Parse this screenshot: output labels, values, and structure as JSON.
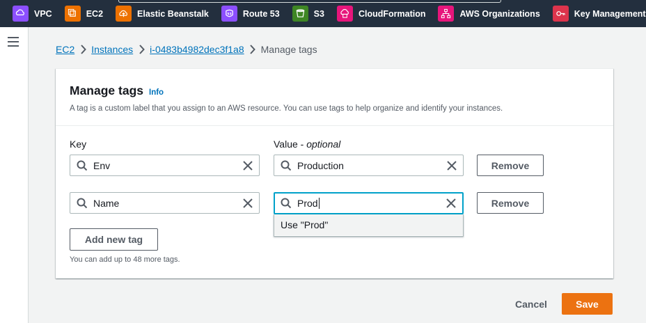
{
  "services": [
    {
      "label": "VPC",
      "icon": "vpc-icon",
      "color": "#8c4fff"
    },
    {
      "label": "EC2",
      "icon": "ec2-icon",
      "color": "#ed7100"
    },
    {
      "label": "Elastic Beanstalk",
      "icon": "elastic-beanstalk-icon",
      "color": "#ed7100"
    },
    {
      "label": "Route 53",
      "icon": "route-53-icon",
      "color": "#8c4fff"
    },
    {
      "label": "S3",
      "icon": "s3-icon",
      "color": "#3f8624"
    },
    {
      "label": "CloudFormation",
      "icon": "cloudformation-icon",
      "color": "#e7157b"
    },
    {
      "label": "AWS Organizations",
      "icon": "aws-organizations-icon",
      "color": "#e7157b"
    },
    {
      "label": "Key Management Service",
      "icon": "kms-icon",
      "color": "#dd344c"
    }
  ],
  "breadcrumb": {
    "items": [
      "EC2",
      "Instances",
      "i-0483b4982dec3f1a8"
    ],
    "current": "Manage tags"
  },
  "panel": {
    "title": "Manage tags",
    "info": "Info",
    "description": "A tag is a custom label that you assign to an AWS resource. You can use tags to help organize and identify your instances."
  },
  "columns": {
    "key": "Key",
    "value": "Value - ",
    "value_optional": "optional"
  },
  "tags": [
    {
      "key": "Env",
      "value": "Production",
      "remove": "Remove"
    },
    {
      "key": "Name",
      "value": "Prod",
      "remove": "Remove"
    }
  ],
  "suggestion": "Use \"Prod\"",
  "add_button": "Add new tag",
  "hint": "You can add up to 48 more tags.",
  "footer": {
    "cancel": "Cancel",
    "save": "Save"
  },
  "colors": {
    "topbar": "#232f3e",
    "link": "#0073bb",
    "primary": "#ec7211",
    "focus": "#00a1c9"
  }
}
